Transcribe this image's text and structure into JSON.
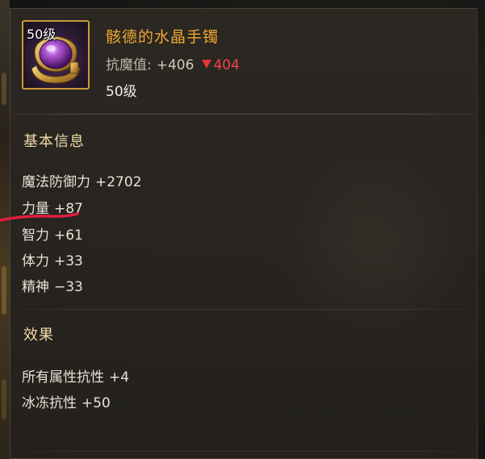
{
  "item": {
    "level_badge": "50级",
    "name": "骸德的水晶手镯",
    "magic_resist_label": "抗魔值:",
    "magic_resist_value": "+406",
    "compare_indicator": "down-triangle-icon",
    "compare_value": "404",
    "required_level": "50级"
  },
  "basic_info": {
    "title": "基本信息",
    "stats": [
      {
        "label": "魔法防御力",
        "value": "+2702"
      },
      {
        "label": "力量",
        "value": "+87"
      },
      {
        "label": "智力",
        "value": "+61"
      },
      {
        "label": "体力",
        "value": "+33"
      },
      {
        "label": "精神",
        "value": "−33"
      }
    ]
  },
  "effects": {
    "title": "效果",
    "stats": [
      {
        "label": "所有属性抗性",
        "value": "+4"
      },
      {
        "label": "冰冻抗性",
        "value": "+50"
      }
    ]
  },
  "colors": {
    "item_name": "#f0a733",
    "section_title": "#f0d9a6",
    "decrease": "#e0363a",
    "icon_border": "#c89a3a",
    "annotation_stroke": "#e01e3c"
  }
}
